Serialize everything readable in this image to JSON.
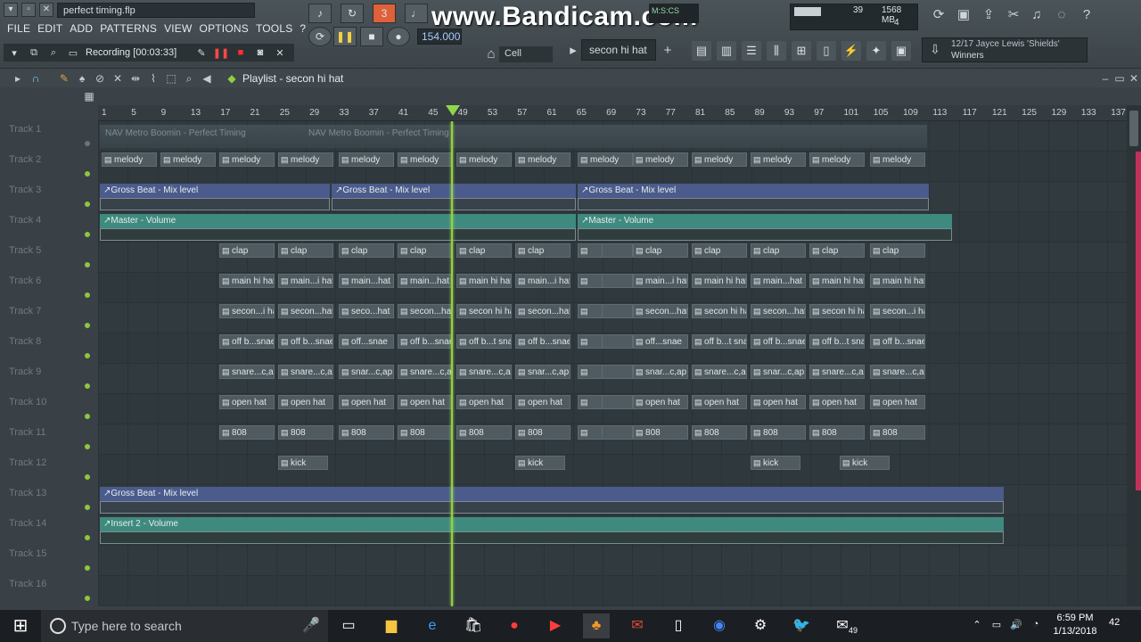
{
  "app": {
    "file_title": "perfect timing.flp",
    "menu": [
      "FILE",
      "EDIT",
      "ADD",
      "PATTERNS",
      "VIEW",
      "OPTIONS",
      "TOOLS",
      "?"
    ],
    "recording_label": "Recording [00:03:33]",
    "tempo": "154.000",
    "snap": "Cell",
    "pattern_selector": "secon hi hat",
    "cpu": "39",
    "memory": "1568 MB",
    "polyphony": "4",
    "news_line1": "12/17  Jayce Lewis 'Shields'",
    "news_line2": "Winners",
    "time_display": "M:S:CS",
    "watermark": "www.Bandicam.com"
  },
  "playlist": {
    "title": "Playlist - secon hi hat",
    "ruler_ticks": [
      "1",
      "5",
      "9",
      "13",
      "17",
      "21",
      "25",
      "29",
      "33",
      "37",
      "41",
      "45",
      "49",
      "53",
      "57",
      "61",
      "65",
      "69",
      "73",
      "77",
      "81",
      "85",
      "89",
      "93",
      "97",
      "101",
      "105",
      "109",
      "113",
      "117",
      "121",
      "125",
      "129",
      "133",
      "137"
    ],
    "tracks": [
      "Track 1",
      "Track 2",
      "Track 3",
      "Track 4",
      "Track 5",
      "Track 6",
      "Track 7",
      "Track 8",
      "Track 9",
      "Track 10",
      "Track 11",
      "Track 12",
      "Track 13",
      "Track 14",
      "Track 15",
      "Track 16"
    ],
    "audio_clip": "NAV  Metro Boomin - Perfect Timing",
    "automation": {
      "gross_beat": "Gross Beat - Mix level",
      "master_volume": "Master - Volume",
      "insert2_volume": "Insert 2 - Volume"
    },
    "clip_names": {
      "melody": "melody",
      "clap": "clap",
      "main_hat": "main hi hat",
      "main_hat_short": "main...i hat",
      "main_short": "main...hat",
      "secon_hat": "secon hi hat",
      "secon_short": "secon...hat",
      "seco_short": "seco...hat",
      "secon_i_hat": "secon...i hat",
      "off_snare": "off b...snae",
      "off_short": "off...snae",
      "off_bt_snare": "off b...t snae",
      "snare_cap": "snare...c,ap",
      "snar_cap": "snar...c,ap",
      "open_hat": "open hat",
      "808": "808",
      "kick": "kick"
    }
  },
  "taskbar": {
    "search_placeholder": "Type here to search",
    "time": "6:59 PM",
    "date": "1/13/2018",
    "notifications": "42",
    "mail_badge": "49"
  }
}
